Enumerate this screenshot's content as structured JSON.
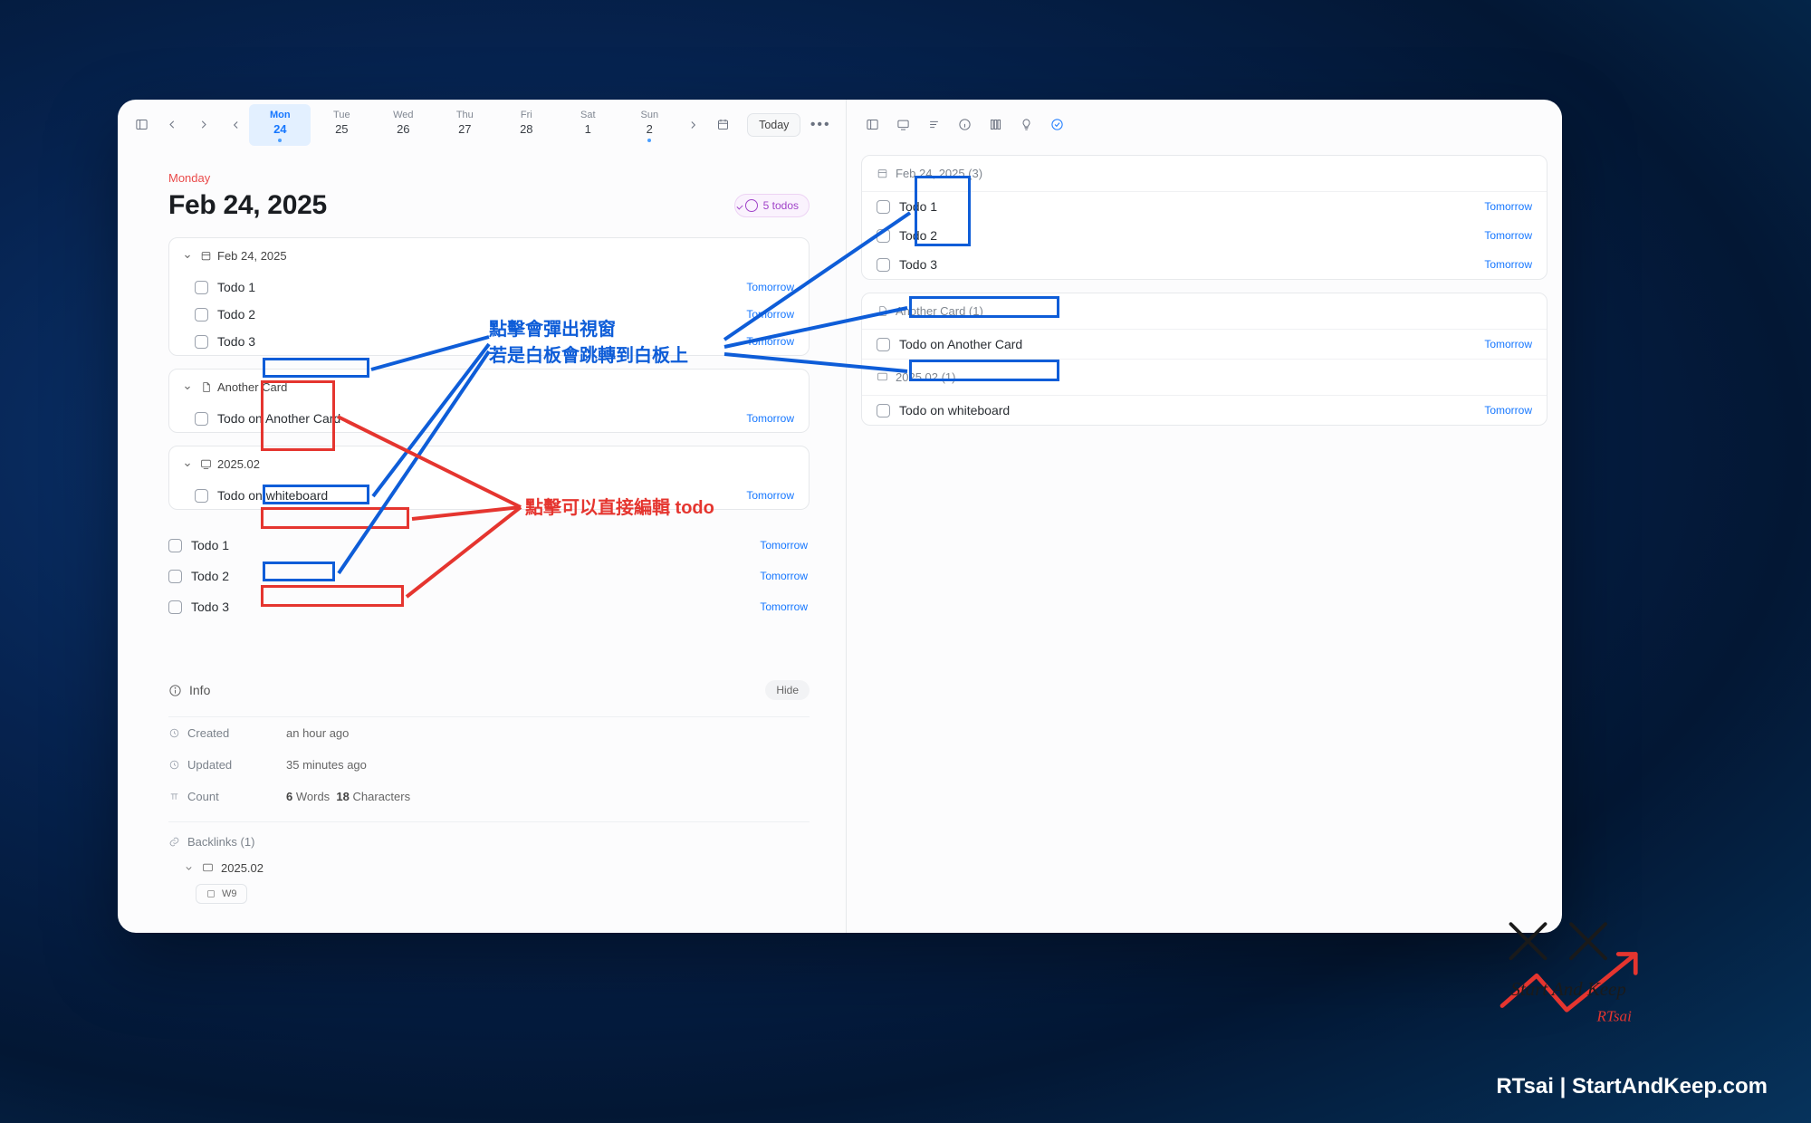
{
  "toolbar": {
    "today_label": "Today"
  },
  "week": {
    "days": [
      {
        "dow": "Mon",
        "num": "24",
        "selected": true,
        "hasdot": true
      },
      {
        "dow": "Tue",
        "num": "25"
      },
      {
        "dow": "Wed",
        "num": "26"
      },
      {
        "dow": "Thu",
        "num": "27"
      },
      {
        "dow": "Fri",
        "num": "28"
      },
      {
        "dow": "Sat",
        "num": "1"
      },
      {
        "dow": "Sun",
        "num": "2",
        "hasdot": true
      }
    ]
  },
  "page": {
    "dow_label": "Monday",
    "title": "Feb 24, 2025",
    "todos_badge": "5 todos"
  },
  "cards": [
    {
      "id": "c1",
      "icon": "calendar",
      "label": "Feb 24, 2025",
      "todos": [
        {
          "text": "Todo 1",
          "due": "Tomorrow"
        },
        {
          "text": "Todo 2",
          "due": "Tomorrow"
        },
        {
          "text": "Todo 3",
          "due": "Tomorrow"
        }
      ]
    },
    {
      "id": "c2",
      "icon": "doc",
      "label": "Another Card",
      "todos": [
        {
          "text": "Todo on Another Card",
          "due": "Tomorrow"
        }
      ]
    },
    {
      "id": "c3",
      "icon": "board",
      "label": "2025.02",
      "todos": [
        {
          "text": "Todo on whiteboard",
          "due": "Tomorrow"
        }
      ]
    }
  ],
  "plain_todos": [
    {
      "text": "Todo 1",
      "due": "Tomorrow"
    },
    {
      "text": "Todo 2",
      "due": "Tomorrow"
    },
    {
      "text": "Todo 3",
      "due": "Tomorrow"
    }
  ],
  "info": {
    "heading": "Info",
    "hide": "Hide",
    "created_k": "Created",
    "created_v": "an hour ago",
    "updated_k": "Updated",
    "updated_v": "35 minutes ago",
    "count_k": "Count",
    "count_words_n": "6",
    "count_words_l": "Words",
    "count_chars_n": "18",
    "count_chars_l": "Characters"
  },
  "backlinks": {
    "heading": "Backlinks (1)",
    "item_label": "2025.02",
    "chip": "W9"
  },
  "right_cards": [
    {
      "icon": "calendar",
      "head": "Feb 24, 2025 (3)",
      "rows": [
        {
          "text": "Todo 1",
          "due": "Tomorrow"
        },
        {
          "text": "Todo 2",
          "due": "Tomorrow"
        },
        {
          "text": "Todo 3",
          "due": "Tomorrow"
        }
      ]
    },
    {
      "icon": "doc",
      "head": "Another Card (1)",
      "rows": [
        {
          "text": "Todo on Another Card",
          "due": "Tomorrow"
        }
      ],
      "sub": {
        "icon": "board",
        "head": "2025.02 (1)",
        "rows": [
          {
            "text": "Todo on whiteboard",
            "due": "Tomorrow"
          }
        ]
      }
    }
  ],
  "annotations": {
    "blue_line1": "點擊會彈出視窗",
    "blue_line2": "若是白板會跳轉到白板上",
    "red_line": "點擊可以直接編輯 todo"
  },
  "attribution": "RTsai | StartAndKeep.com"
}
